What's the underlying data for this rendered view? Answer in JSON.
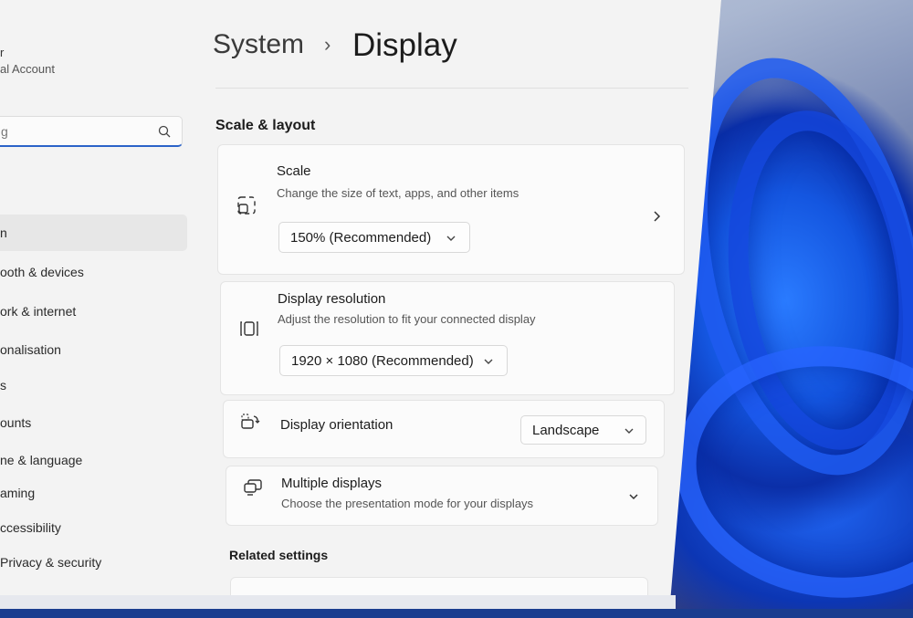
{
  "sidebar": {
    "user_name": "r",
    "account_type": "al Account",
    "search_placeholder": "g",
    "items": [
      {
        "label": "n"
      },
      {
        "label": "ooth & devices"
      },
      {
        "label": "ork & internet"
      },
      {
        "label": "onalisation"
      },
      {
        "label": "s"
      },
      {
        "label": "ounts"
      },
      {
        "label": "ne & language"
      },
      {
        "label": "aming"
      },
      {
        "label": "ccessibility"
      },
      {
        "label": "Privacy & security"
      }
    ]
  },
  "header": {
    "breadcrumb_parent": "System",
    "breadcrumb_separator": "›",
    "page_title": "Display"
  },
  "sections": {
    "scale_layout": "Scale & layout",
    "related_settings": "Related settings"
  },
  "cards": {
    "scale": {
      "title": "Scale",
      "description": "Change the size of text, apps, and other items",
      "value": "150% (Recommended)",
      "icon": "scale-icon"
    },
    "resolution": {
      "title": "Display resolution",
      "description": "Adjust the resolution to fit your connected display",
      "value": "1920 × 1080 (Recommended)",
      "icon": "resolution-icon"
    },
    "orientation": {
      "title": "Display orientation",
      "value": "Landscape",
      "icon": "orientation-icon"
    },
    "multiple": {
      "title": "Multiple displays",
      "description": "Choose the presentation mode for your displays",
      "icon": "multiple-displays-icon"
    }
  },
  "colors": {
    "accent": "#2b63c8",
    "window_bg": "#f3f3f3",
    "card_bg": "#fbfbfb"
  }
}
